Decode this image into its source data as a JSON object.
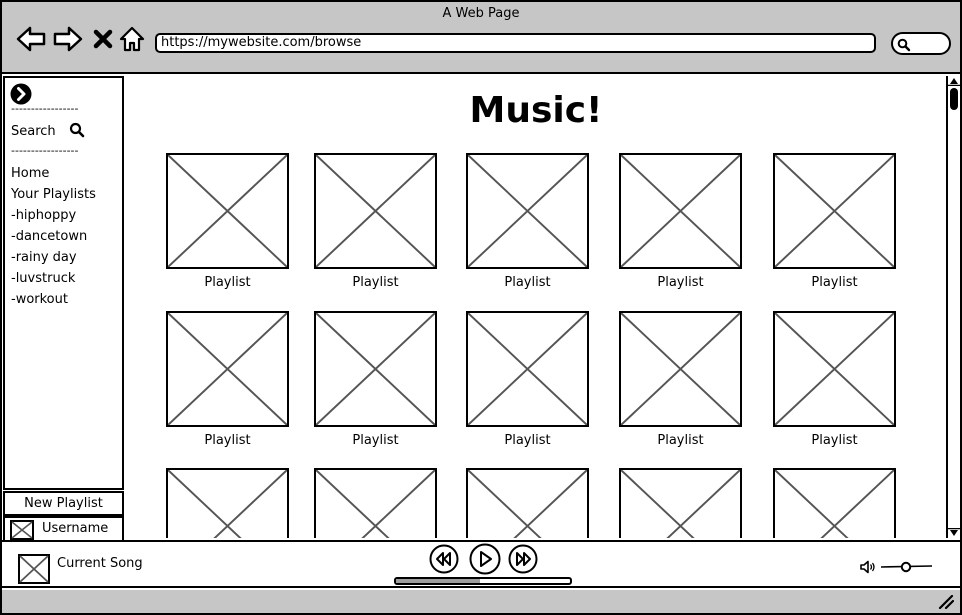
{
  "window": {
    "title": "A Web Page"
  },
  "toolbar": {
    "icons": [
      "back-arrow-icon",
      "forward-arrow-icon",
      "close-icon",
      "home-icon"
    ],
    "url": "https://mywebsite.com/browse",
    "search_icon": "search-icon"
  },
  "sidebar": {
    "toggle_icon": "chevron-right-icon",
    "divider": "-----------------",
    "search_label": "Search",
    "items": [
      {
        "label": "Home"
      },
      {
        "label": "Your Playlists"
      },
      {
        "label": "-hiphoppy"
      },
      {
        "label": "-dancetown"
      },
      {
        "label": "-rainy day"
      },
      {
        "label": "-luvstruck"
      },
      {
        "label": "-workout"
      }
    ],
    "new_playlist_label": "New Playlist",
    "username": "Username"
  },
  "main": {
    "title": "Music!",
    "tiles": [
      {
        "label": "Playlist"
      },
      {
        "label": "Playlist"
      },
      {
        "label": "Playlist"
      },
      {
        "label": "Playlist"
      },
      {
        "label": "Playlist"
      },
      {
        "label": "Playlist"
      },
      {
        "label": "Playlist"
      },
      {
        "label": "Playlist"
      },
      {
        "label": "Playlist"
      },
      {
        "label": "Playlist"
      },
      {
        "label": ""
      },
      {
        "label": ""
      },
      {
        "label": ""
      },
      {
        "label": ""
      },
      {
        "label": ""
      }
    ]
  },
  "player": {
    "current_song": "Current Song",
    "controls": [
      "rewind-icon",
      "play-icon",
      "fast-forward-icon"
    ],
    "progress": 0.48,
    "volume_icon": "speaker-icon"
  },
  "colors": {
    "chrome": "#c6c6c6",
    "border": "#000000",
    "placeholder_stroke": "#555555",
    "progress_fill": "#9e9e9e"
  }
}
